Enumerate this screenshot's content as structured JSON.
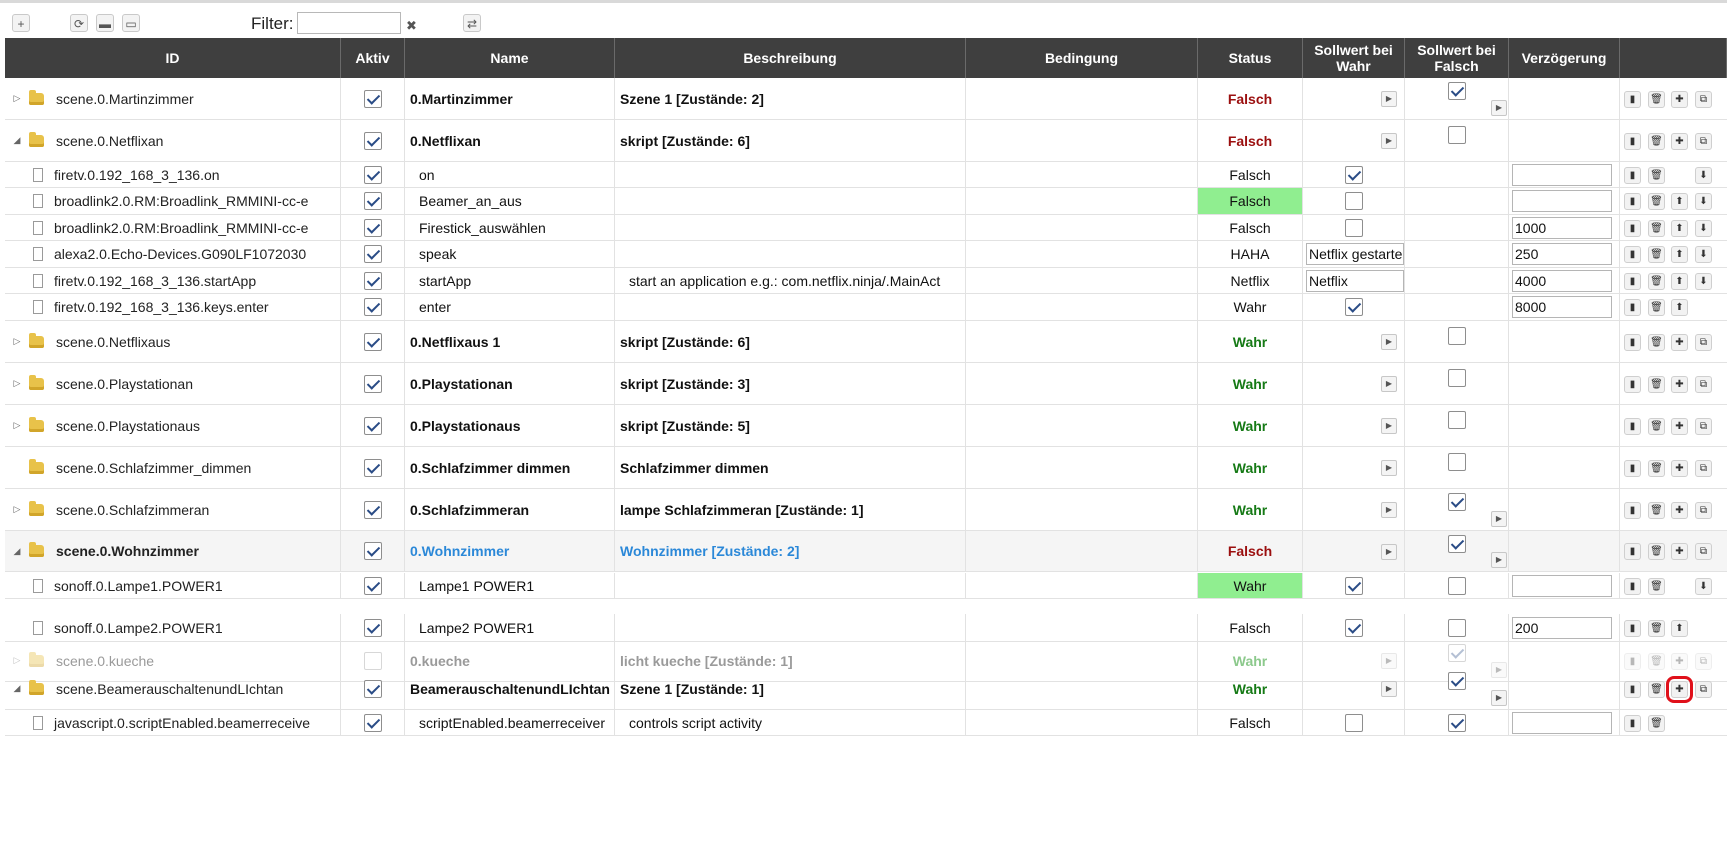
{
  "toolbar": {
    "add": "+",
    "refresh": "⟳",
    "folder": "▬",
    "folder_open": "▭",
    "filter_label": "Filter:",
    "filter_value": "",
    "filter_clear": "✖",
    "swap": "⇄"
  },
  "columns": [
    "ID",
    "Aktiv",
    "Name",
    "Beschreibung",
    "Bedingung",
    "Status",
    "Sollwert bei Wahr",
    "Sollwert bei Falsch",
    "Verzögerung",
    ""
  ],
  "rows": [
    {
      "id": "scene.0.Martinzimmer",
      "kind": "scene",
      "tw": "closed",
      "aktiv": true,
      "name": "0.Martinzimmer",
      "desc": "Szene 1 [Zustände: 2]",
      "status": "Falsch",
      "status_style": "red",
      "sw": "play",
      "sf": "cb-on-play"
    },
    {
      "id": "scene.0.Netflixan",
      "kind": "scene",
      "tw": "open",
      "aktiv": true,
      "name": "0.Netflixan",
      "desc": "skript [Zustände: 6]",
      "status": "Falsch",
      "status_style": "red",
      "sw": "play",
      "sf": "cb-off"
    },
    {
      "id": "firetv.0.192_168_3_136.on",
      "kind": "state",
      "aktiv": true,
      "name": "on",
      "desc": "",
      "status": "Falsch",
      "status_style": "plain",
      "sw": "cb-on",
      "sf": "",
      "ver": "",
      "acts": [
        "del"
      ]
    },
    {
      "id": "broadlink2.0.RM:Broadlink_RMMINI-cc-e",
      "kind": "state",
      "aktiv": true,
      "name": "Beamer_an_aus",
      "desc": "",
      "status": "Falsch",
      "status_style": "hi",
      "sw": "cb-off",
      "sf": "",
      "ver": "",
      "acts": [
        "up",
        "down"
      ]
    },
    {
      "id": "broadlink2.0.RM:Broadlink_RMMINI-cc-e",
      "kind": "state",
      "aktiv": true,
      "name": "Firestick_auswählen",
      "desc": "",
      "status": "Falsch",
      "status_style": "plain",
      "sw": "cb-off",
      "sf": "",
      "ver": "1000",
      "acts": [
        "up",
        "down"
      ]
    },
    {
      "id": "alexa2.0.Echo-Devices.G090LF1072030",
      "kind": "state",
      "aktiv": true,
      "name": "speak",
      "desc": "",
      "status": "HAHA",
      "status_style": "plain",
      "sw": "inp:Netflix gestarte",
      "sf": "",
      "ver": "250",
      "acts": [
        "up",
        "down"
      ]
    },
    {
      "id": "firetv.0.192_168_3_136.startApp",
      "kind": "state",
      "aktiv": true,
      "name": "startApp",
      "desc": "start an application e.g.: com.netflix.ninja/.MainAct",
      "status": "Netflix",
      "status_style": "plain",
      "sw": "inp:Netflix",
      "sf": "",
      "ver": "4000",
      "acts": [
        "up",
        "down"
      ]
    },
    {
      "id": "firetv.0.192_168_3_136.keys.enter",
      "kind": "state",
      "aktiv": true,
      "name": "enter",
      "desc": "",
      "status": "Wahr",
      "status_style": "plain",
      "sw": "cb-on",
      "sf": "",
      "ver": "8000",
      "acts": [
        "up"
      ]
    },
    {
      "id": "scene.0.Netflixaus",
      "kind": "scene",
      "tw": "closed",
      "aktiv": true,
      "name": "0.Netflixaus 1",
      "desc": "skript [Zustände: 6]",
      "status": "Wahr",
      "status_style": "green",
      "sw": "play",
      "sf": "cb-off"
    },
    {
      "id": "scene.0.Playstationan",
      "kind": "scene",
      "tw": "closed",
      "aktiv": true,
      "name": "0.Playstationan",
      "desc": "skript [Zustände: 3]",
      "status": "Wahr",
      "status_style": "green",
      "sw": "play",
      "sf": "cb-off"
    },
    {
      "id": "scene.0.Playstationaus",
      "kind": "scene",
      "tw": "closed",
      "aktiv": true,
      "name": "0.Playstationaus",
      "desc": "skript [Zustände: 5]",
      "status": "Wahr",
      "status_style": "green",
      "sw": "play",
      "sf": "cb-off"
    },
    {
      "id": "scene.0.Schlafzimmer_dimmen",
      "kind": "scene",
      "tw": "none",
      "aktiv": true,
      "name": "0.Schlafzimmer dimmen",
      "desc": "Schlafzimmer dimmen",
      "status": "Wahr",
      "status_style": "green",
      "sw": "play",
      "sf": "cb-off"
    },
    {
      "id": "scene.0.Schlafzimmeran",
      "kind": "scene",
      "tw": "closed",
      "aktiv": true,
      "name": "0.Schlafzimmeran",
      "desc": "lampe Schlafzimmeran [Zustände: 1]",
      "status": "Wahr",
      "status_style": "green",
      "sw": "play",
      "sf": "cb-on-play"
    },
    {
      "id": "scene.0.Wohnzimmer",
      "kind": "scene",
      "tw": "open",
      "bold_id": true,
      "hl": true,
      "aktiv": true,
      "name": "0.Wohnzimmer",
      "desc": "Wohnzimmer [Zustände: 2]",
      "name_style": "blue",
      "status": "Falsch",
      "status_style": "red",
      "sw": "play",
      "sf": "cb-on-play"
    },
    {
      "id": "sonoff.0.Lampe1.POWER1",
      "kind": "state",
      "aktiv": true,
      "name": "Lampe1 POWER1",
      "desc": "",
      "status": "Wahr",
      "status_style": "hi",
      "sw": "cb-on",
      "sf": "cb-off",
      "ver": "",
      "acts": [
        "down"
      ]
    },
    {
      "id": "sonoff.0.Lampe2.POWER1",
      "kind": "state",
      "aktiv": true,
      "name": "Lampe2 POWER1",
      "desc": "",
      "status": "Falsch",
      "status_style": "plain",
      "sw": "cb-on",
      "sf": "cb-off",
      "ver": "200",
      "acts": [
        "up"
      ]
    },
    {
      "id": "scene.0.kueche",
      "kind": "scene",
      "tw": "closed",
      "disabled": true,
      "aktiv": false,
      "name": "0.kueche",
      "desc": "licht kueche [Zustände: 1]",
      "status": "Wahr",
      "status_style": "green-light",
      "sw": "play",
      "sf": "cb-on-play"
    },
    {
      "id": "scene.BeamerauschaltenundLIchtan",
      "kind": "scene",
      "tw": "open",
      "aktiv": true,
      "name": "BeamerauschaltenundLIchtan",
      "desc": "Szene 1 [Zustände: 1]",
      "status": "Wahr",
      "status_style": "green",
      "sw": "play",
      "sf": "cb-on-play",
      "highlight_add": true
    },
    {
      "id": "javascript.0.scriptEnabled.beamerreceive",
      "kind": "state",
      "aktiv": true,
      "name": "scriptEnabled.beamerreceiver",
      "desc": "controls script activity",
      "status": "Falsch",
      "status_style": "plain",
      "sw": "cb-off",
      "sf": "cb-on",
      "ver": "",
      "acts": []
    }
  ],
  "icons": {
    "scene_actions": [
      "copy-icon",
      "trash-icon",
      "plus-icon",
      "clone-icon"
    ],
    "state_actions": [
      "copy-icon",
      "trash-icon"
    ]
  }
}
